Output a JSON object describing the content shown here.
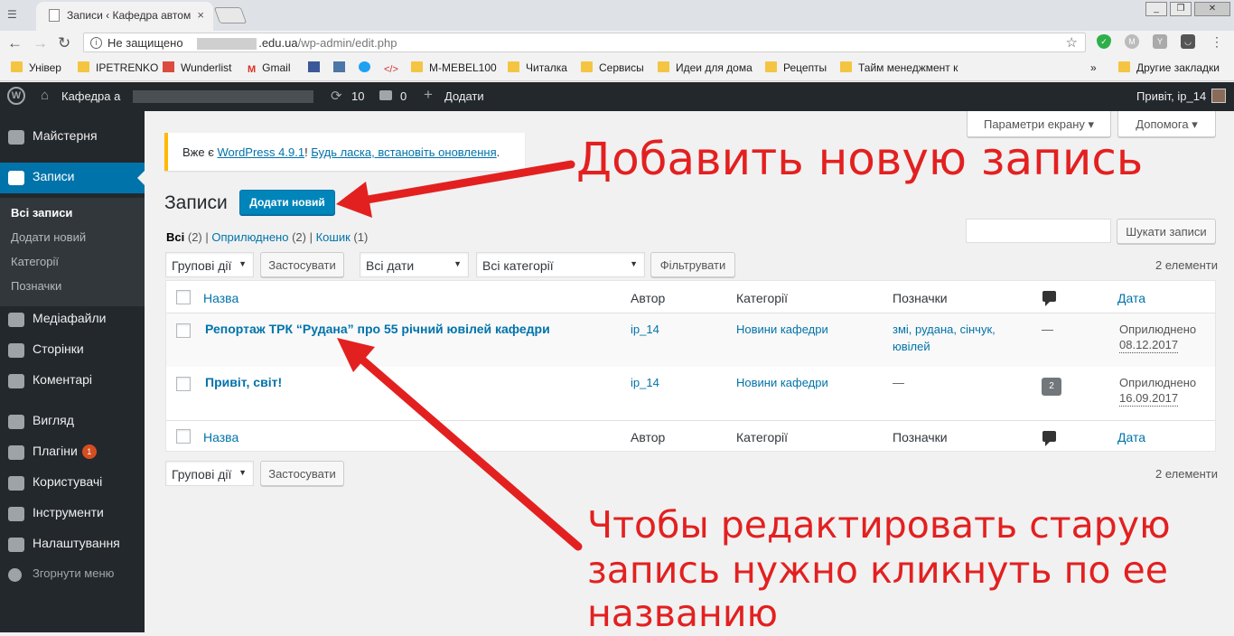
{
  "browser": {
    "tab_title": "Записи ‹ Кафедра автом",
    "security_label": "Не защищено",
    "url_domain": ".edu.ua",
    "url_path": "/wp-admin/edit.php",
    "bookmarks": [
      "Універ",
      "IPETRENKO",
      "Wunderlist",
      "Gmail",
      "M-MEBEL100",
      "Читалка",
      "Сервисы",
      "Идеи для дома",
      "Рецепты",
      "Тайм менеджмент к"
    ],
    "other_bookmarks": "Другие закладки",
    "overflow": "»"
  },
  "adminbar": {
    "site_name": "Кафедра а",
    "updates_count": "10",
    "comments_count": "0",
    "add_label": "Додати",
    "greeting": "Привіт, ip_14"
  },
  "sidebar": {
    "items": [
      "Майстерня",
      "Записи",
      "Медіафайли",
      "Сторінки",
      "Коментарі",
      "Вигляд",
      "Плагіни",
      "Користувачі",
      "Інструменти",
      "Налаштування",
      "Згорнути меню"
    ],
    "plugins_badge": "1",
    "submenu": [
      "Всі записи",
      "Додати новий",
      "Категорії",
      "Позначки"
    ]
  },
  "screen": {
    "options_label": "Параметри екрану",
    "help_label": "Допомога"
  },
  "notice": {
    "prefix": "Вже є ",
    "link1": "WordPress 4.9.1",
    "middle": "! ",
    "link2": "Будь ласка, встановіть оновлення",
    "suffix": "."
  },
  "page": {
    "title": "Записи",
    "add_new": "Додати новий",
    "filters": {
      "all": "Всі",
      "all_count": "(2)",
      "published": "Оприлюднено",
      "published_count": "(2)",
      "trash": "Кошик",
      "trash_count": "(1)"
    },
    "search_placeholder": "",
    "search_button": "Шукати записи",
    "bulk_actions": "Групові дії",
    "apply": "Застосувати",
    "all_dates": "Всі дати",
    "all_categories": "Всі категорії",
    "filter_button": "Фільтрувати",
    "items_count": "2 елементи"
  },
  "table": {
    "columns": {
      "title": "Назва",
      "author": "Автор",
      "categories": "Категорії",
      "tags": "Позначки",
      "date": "Дата"
    },
    "rows": [
      {
        "title": "Репортаж ТРК “Рудана” про 55 річний ювілей кафедри",
        "author": "ip_14",
        "category": "Новини кафедри",
        "tags_line1": "змі, рудана, сінчук,",
        "tags_line2": "ювілей",
        "comments": "—",
        "status": "Оприлюднено",
        "date": "08.12.2017"
      },
      {
        "title": "Привіт, світ!",
        "author": "ip_14",
        "category": "Новини кафедри",
        "tags_line1": "—",
        "comments": "2",
        "status": "Оприлюднено",
        "date": "16.09.2017"
      }
    ]
  },
  "annotations": {
    "add": "Добавить новую запись",
    "edit_line1": "Чтобы редактировать старую",
    "edit_line2": "запись нужно кликнуть по ее",
    "edit_line3": "названию"
  }
}
